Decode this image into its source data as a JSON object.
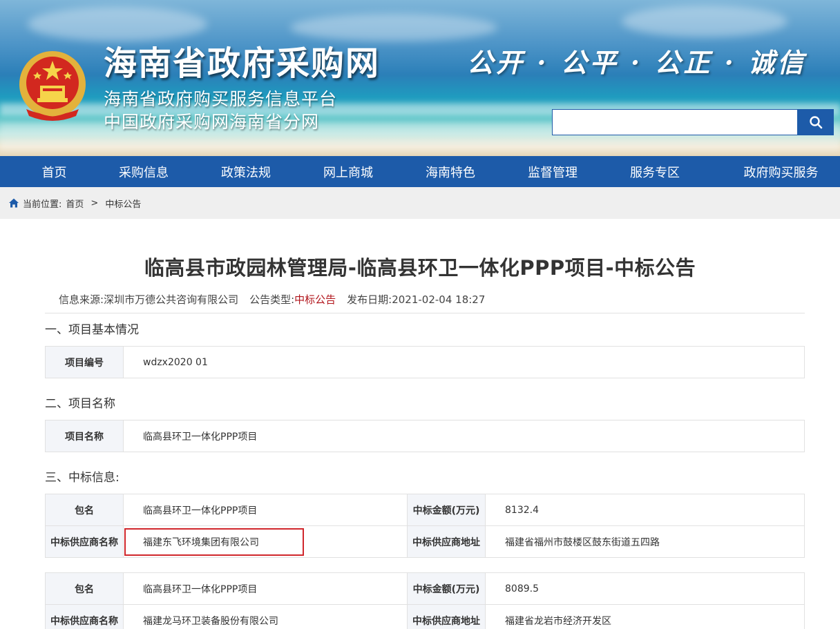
{
  "header": {
    "title": "海南省政府采购网",
    "subtitle1": "海南省政府购买服务信息平台",
    "subtitle2": "中国政府采购网海南省分网",
    "slogan": "公开 · 公平 · 公正 · 诚信",
    "search_placeholder": ""
  },
  "nav": {
    "items": [
      "首页",
      "采购信息",
      "政策法规",
      "网上商城",
      "海南特色",
      "监督管理",
      "服务专区",
      "政府购买服务"
    ]
  },
  "breadcrumb": {
    "prefix": "当前位置:",
    "home": "首页",
    "separator": ">",
    "current": "中标公告"
  },
  "article": {
    "title": "临高县市政园林管理局-临高县环卫一体化PPP项目-中标公告",
    "source_label": "信息来源:",
    "source_value": "深圳市万德公共咨询有限公司",
    "type_label": "公告类型:",
    "type_value": "中标公告",
    "date_label": "发布日期:",
    "date_value": "2021-02-04 18:27"
  },
  "sections": {
    "s1": {
      "heading": "一、项目基本情况",
      "label": "项目编号",
      "value": "wdzx2020 01"
    },
    "s2": {
      "heading": "二、项目名称",
      "label": "项目名称",
      "value": "临高县环卫一体化PPP项目"
    },
    "s3": {
      "heading": "三、中标信息:",
      "label_package": "包名",
      "label_amount": "中标金额(万元)",
      "label_supplier": "中标供应商名称",
      "label_address": "中标供应商地址",
      "bids": [
        {
          "package": "临高县环卫一体化PPP项目",
          "amount": "8132.4",
          "supplier": "福建东飞环境集团有限公司",
          "address": "福建省福州市鼓楼区鼓东街道五四路"
        },
        {
          "package": "临高县环卫一体化PPP项目",
          "amount": "8089.5",
          "supplier": "福建龙马环卫装备股份有限公司",
          "address": "福建省龙岩市经济开发区"
        }
      ]
    }
  },
  "colors": {
    "nav_blue": "#1d5ba9",
    "accent_red": "#b1141b",
    "highlight_red": "#d0262b"
  }
}
